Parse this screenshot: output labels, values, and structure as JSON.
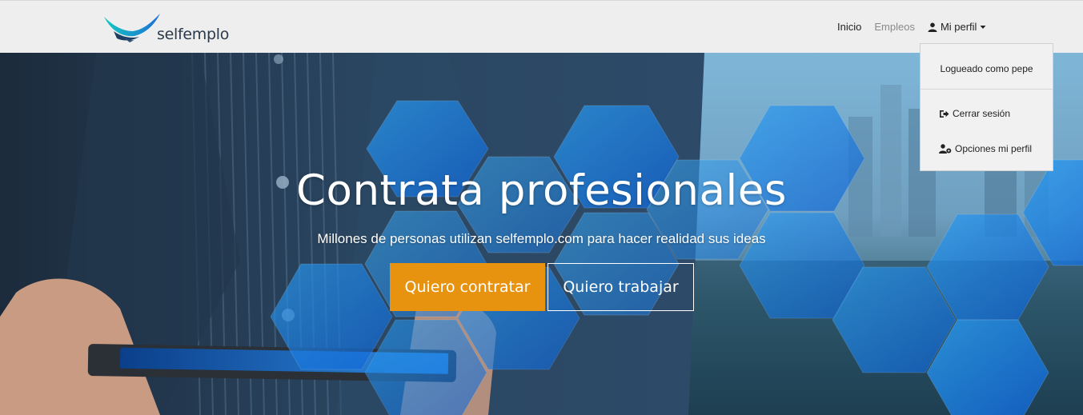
{
  "brand": {
    "name": "selfemplo",
    "logo_icon": "bird-logo-icon"
  },
  "nav": {
    "links": [
      {
        "label": "Inicio"
      },
      {
        "label": "Empleos"
      },
      {
        "label": "Mi perfil",
        "icon": "user-icon",
        "caret": "caret-down-icon"
      }
    ]
  },
  "dropdown": {
    "header": "Logueado como pepe",
    "items": [
      {
        "label": "Cerrar sesión",
        "icon": "sign-out-icon"
      },
      {
        "label": "Opciones mi perfil",
        "icon": "user-cog-icon"
      }
    ]
  },
  "hero": {
    "title": "Contrata profesionales",
    "subtitle": "Millones de personas utilizan selfemplo.com para hacer realidad sus ideas",
    "buttons": {
      "hire": "Quiero contratar",
      "work": "Quiero trabajar"
    }
  },
  "colors": {
    "navbar_bg": "#eeeeee",
    "accent_orange": "#e8930f",
    "hex_blue": "#1e7fe0",
    "text_dark": "#222222"
  }
}
